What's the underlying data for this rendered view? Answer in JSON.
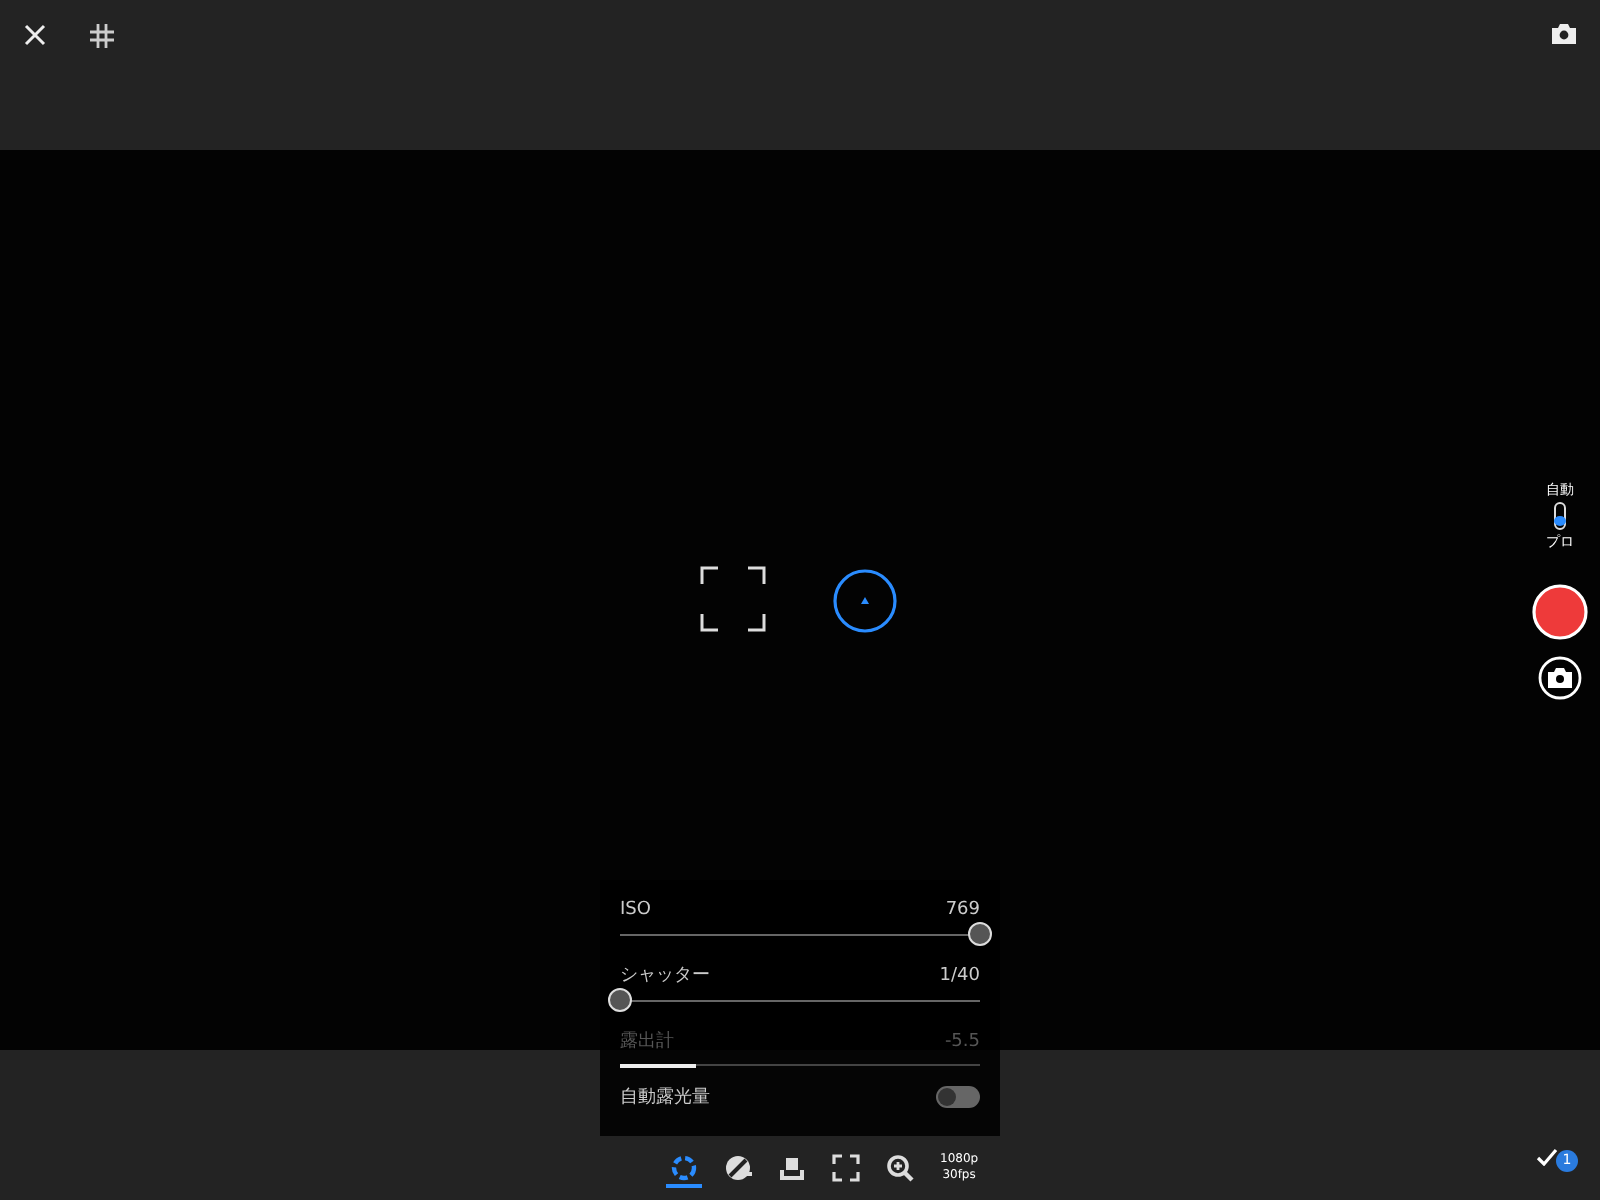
{
  "mode": {
    "options": [
      {
        "label": "自動",
        "selected": false
      },
      {
        "label": "プロ",
        "selected": true
      }
    ]
  },
  "panel": {
    "rows": [
      {
        "kind": "slider",
        "label": "ISO",
        "reading": "769",
        "level": 1
      },
      {
        "kind": "slider",
        "label": "シャッター",
        "reading": "1/40",
        "level": 0
      },
      {
        "kind": "meter",
        "label": "露出計",
        "reading": "-5.5",
        "level": 0.21
      },
      {
        "kind": "toggle",
        "label": "自動露光量",
        "on": false
      }
    ]
  },
  "toolbar": {
    "items": [
      {
        "kind": "exposure",
        "selected": true
      },
      {
        "kind": "color",
        "selected": false
      },
      {
        "kind": "white-balance",
        "selected": false
      },
      {
        "kind": "frame",
        "selected": false
      },
      {
        "kind": "zoom",
        "selected": false
      }
    ],
    "resolution": "1080p",
    "framerate": "30fps"
  },
  "badge": "1"
}
